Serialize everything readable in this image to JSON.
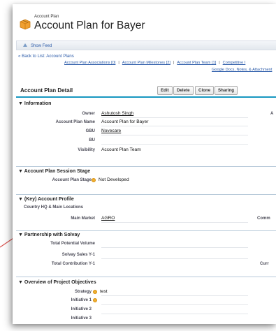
{
  "header": {
    "object_label": "Account Plan",
    "title": "Account Plan for Bayer"
  },
  "feed": {
    "show_feed": "Show Feed"
  },
  "links": {
    "back": "« Back to List: Account Plans",
    "related": [
      "Account Plan Associations [0]",
      "Account Plan Milestones [2]",
      "Account Plan Team [1]",
      "Competitive I"
    ],
    "related_line2": "Google Docs, Notes, & Attachment"
  },
  "detail": {
    "title": "Account Plan Detail",
    "buttons": {
      "edit": "Edit",
      "delete": "Delete",
      "clone": "Clone",
      "sharing": "Sharing"
    }
  },
  "sections": {
    "information": {
      "title": "▼ Information",
      "owner_label": "Owner",
      "owner_value": "Ashutosh Singh",
      "right_cut_label": "A",
      "name_label": "Account Plan Name",
      "name_value": "Account Plan for Bayer",
      "gbu_label": "GBU",
      "gbu_value": "Novecare",
      "bu_label": "BU",
      "bu_value": "",
      "visibility_label": "Visibility",
      "visibility_value": "Account Plan Team"
    },
    "session": {
      "title": "▼ Account Plan Session Stage",
      "stage_label": "Account Plan Stage",
      "stage_value": "Not Developed"
    },
    "profile": {
      "title": "▼ (Key) Account Profile",
      "country_label": "Country HQ & Main Locations",
      "market_label": "Main Market",
      "market_value": "AGRO",
      "right_cut_label": "Comm"
    },
    "partnership": {
      "title": "▼ Partnership with Solvay",
      "potential_label": "Total Potential Volume",
      "sales_label": "Solvay Sales Y-1",
      "contribution_label": "Total Contribution Y-1",
      "right_cut_label": "Curr"
    },
    "objectives": {
      "title": "▼ Overview of Project Objectives",
      "strategy_label": "Strategy",
      "strategy_value": "test",
      "initiative1_label": "Initiative 1",
      "initiative2_label": "Initiative 2",
      "initiative3_label": "Initiative 3"
    }
  },
  "colors": {
    "link": "#2a5aa8",
    "section_rule": "#1797c0",
    "icon_orange": "#f0a030",
    "arrow_red": "#d9534f"
  },
  "icons": [
    "account-plan-icon",
    "feed-icon",
    "help-icon",
    "annotation-arrow"
  ]
}
